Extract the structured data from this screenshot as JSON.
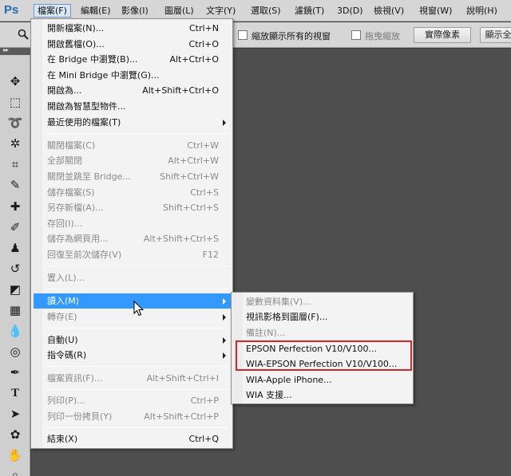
{
  "app": {
    "logo": "Ps"
  },
  "menubar": {
    "items": [
      {
        "label": "檔案(F)"
      },
      {
        "label": "編輯(E)"
      },
      {
        "label": "影像(I)"
      },
      {
        "label": "圖層(L)"
      },
      {
        "label": "文字(Y)"
      },
      {
        "label": "選取(S)"
      },
      {
        "label": "濾鏡(T)"
      },
      {
        "label": "3D(D)"
      },
      {
        "label": "檢視(V)"
      },
      {
        "label": "視窗(W)"
      },
      {
        "label": "說明(H)"
      }
    ]
  },
  "options_bar": {
    "zoom_all_windows_label": "縮放顯示所有的視窗",
    "scrubby_zoom_label": "拖曳縮放",
    "actual_pixels_label": "實際像素",
    "fit_screen_label": "顯示全"
  },
  "file_menu": {
    "items": [
      {
        "label": "開新檔案(N)...",
        "shortcut": "Ctrl+N"
      },
      {
        "label": "開啟舊檔(O)...",
        "shortcut": "Ctrl+O"
      },
      {
        "label": "在 Bridge 中瀏覽(B)...",
        "shortcut": "Alt+Ctrl+O"
      },
      {
        "label": "在 Mini Bridge 中瀏覽(G)...",
        "shortcut": ""
      },
      {
        "label": "開啟為...",
        "shortcut": "Alt+Shift+Ctrl+O"
      },
      {
        "label": "開啟為智慧型物件...",
        "shortcut": ""
      },
      {
        "label": "最近使用的檔案(T)",
        "shortcut": ""
      },
      {
        "label": "關閉檔案(C)",
        "shortcut": "Ctrl+W"
      },
      {
        "label": "全部關閉",
        "shortcut": "Alt+Ctrl+W"
      },
      {
        "label": "關閉並跳至 Bridge...",
        "shortcut": "Shift+Ctrl+W"
      },
      {
        "label": "儲存檔案(S)",
        "shortcut": "Ctrl+S"
      },
      {
        "label": "另存新檔(A)...",
        "shortcut": "Shift+Ctrl+S"
      },
      {
        "label": "存回(I)...",
        "shortcut": ""
      },
      {
        "label": "儲存為網頁用...",
        "shortcut": "Alt+Shift+Ctrl+S"
      },
      {
        "label": "回復至前次儲存(V)",
        "shortcut": "F12"
      },
      {
        "label": "置入(L)...",
        "shortcut": ""
      },
      {
        "label": "讀入(M)",
        "shortcut": ""
      },
      {
        "label": "轉存(E)",
        "shortcut": ""
      },
      {
        "label": "自動(U)",
        "shortcut": ""
      },
      {
        "label": "指令碼(R)",
        "shortcut": ""
      },
      {
        "label": "檔案資訊(F)...",
        "shortcut": "Alt+Shift+Ctrl+I"
      },
      {
        "label": "列印(P)...",
        "shortcut": "Ctrl+P"
      },
      {
        "label": "列印一份拷貝(Y)",
        "shortcut": "Alt+Shift+Ctrl+P"
      },
      {
        "label": "結束(X)",
        "shortcut": "Ctrl+Q"
      }
    ]
  },
  "import_submenu": {
    "items": [
      {
        "label": "變數資料集(V)..."
      },
      {
        "label": "視訊影格到圖層(F)..."
      },
      {
        "label": "備註(N)..."
      },
      {
        "label": "EPSON Perfection V10/V100..."
      },
      {
        "label": "WIA-EPSON Perfection V10/V100..."
      },
      {
        "label": "WIA-Apple iPhone..."
      },
      {
        "label": "WIA 支援..."
      }
    ]
  },
  "colors": {
    "highlight": "#3399ff",
    "annotation_box": "#d42626"
  }
}
